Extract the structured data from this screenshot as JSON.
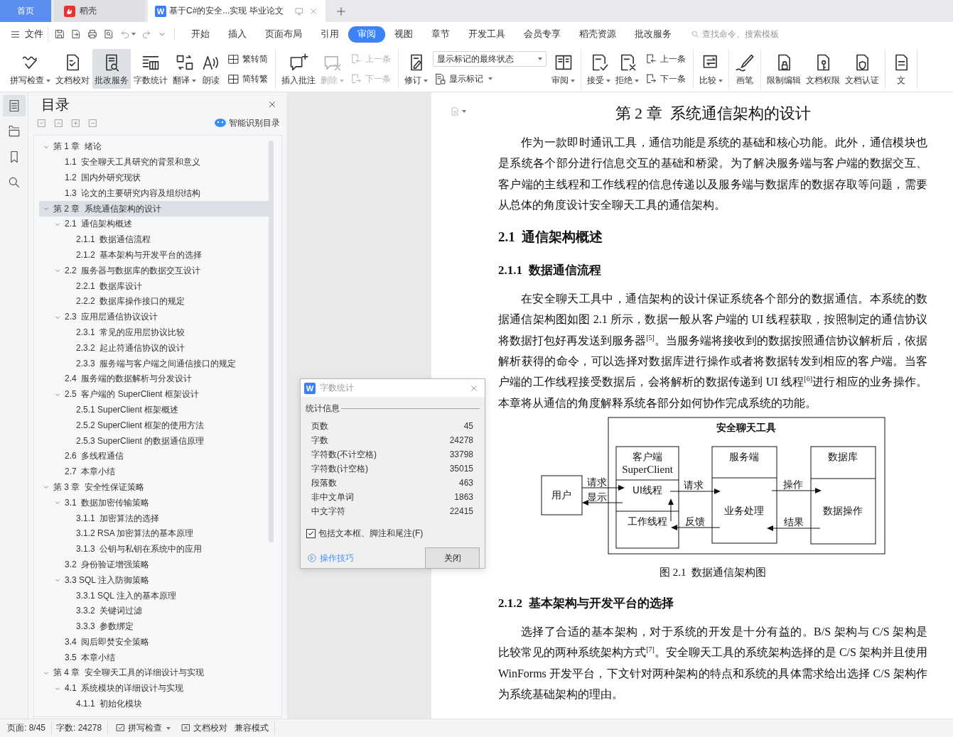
{
  "tabs": [
    {
      "kind": "home",
      "label": "首页",
      "selected": false
    },
    {
      "kind": "app",
      "label": "稻壳",
      "selected": false
    },
    {
      "kind": "document",
      "logo": "W",
      "label": "基于C#的安全...实现 毕业论文",
      "selected": true
    }
  ],
  "menu": {
    "file": "文件",
    "tabs": [
      {
        "label": "开始",
        "selected": false
      },
      {
        "label": "插入",
        "selected": false
      },
      {
        "label": "页面布局",
        "selected": false
      },
      {
        "label": "引用",
        "selected": false
      },
      {
        "label": "审阅",
        "selected": true
      },
      {
        "label": "视图",
        "selected": false
      },
      {
        "label": "章节",
        "selected": false
      },
      {
        "label": "开发工具",
        "selected": false
      },
      {
        "label": "会员专享",
        "selected": false
      },
      {
        "label": "稻壳资源",
        "selected": false
      },
      {
        "label": "批改服务",
        "selected": false
      }
    ],
    "search": {
      "placeholder": "查找命令、搜索模板"
    }
  },
  "ribbon": [
    [
      {
        "kind": "large",
        "label": "拼写检查",
        "menu": true,
        "disabled": false,
        "active": false
      },
      {
        "kind": "large",
        "label": "文档校对",
        "menu": false,
        "disabled": false,
        "active": false
      },
      {
        "kind": "large",
        "label": "批改服务",
        "menu": false,
        "disabled": false,
        "active": true
      },
      {
        "kind": "large",
        "label": "字数统计",
        "menu": false,
        "disabled": false,
        "active": false
      },
      {
        "kind": "large",
        "label": "翻译",
        "menu": true,
        "disabled": false,
        "active": false
      },
      {
        "kind": "large",
        "label": "朗读",
        "menu": false,
        "disabled": false,
        "active": false
      },
      {
        "kind": "stack",
        "items": [
          {
            "kind": "small",
            "label": "繁转简",
            "menu": false,
            "disabled": false
          },
          {
            "kind": "small",
            "label": "简转繁",
            "menu": false,
            "disabled": false
          }
        ]
      }
    ],
    [
      {
        "kind": "large",
        "label": "插入批注",
        "menu": false,
        "disabled": false,
        "active": false
      },
      {
        "kind": "large",
        "label": "删除",
        "menu": true,
        "disabled": true,
        "active": false
      },
      {
        "kind": "stack",
        "items": [
          {
            "kind": "small",
            "label": "上一条",
            "menu": false,
            "disabled": true
          },
          {
            "kind": "small",
            "label": "下一条",
            "menu": false,
            "disabled": true
          }
        ]
      }
    ],
    [
      {
        "kind": "large",
        "label": "修订",
        "menu": true,
        "disabled": false,
        "active": false
      },
      {
        "kind": "stack",
        "items": [
          {
            "kind": "select",
            "value": "显示标记的最终状态"
          },
          {
            "kind": "small",
            "label": "显示标记",
            "menu": true,
            "disabled": false
          }
        ]
      },
      {
        "kind": "large",
        "label": "审阅",
        "menu": true,
        "disabled": false,
        "active": false
      }
    ],
    [
      {
        "kind": "large",
        "label": "接受",
        "menu": true,
        "disabled": false,
        "active": false
      },
      {
        "kind": "large",
        "label": "拒绝",
        "menu": true,
        "disabled": false,
        "active": false
      },
      {
        "kind": "stack",
        "items": [
          {
            "kind": "small",
            "label": "上一条",
            "menu": false,
            "disabled": false
          },
          {
            "kind": "small",
            "label": "下一条",
            "menu": false,
            "disabled": false
          }
        ]
      }
    ],
    [
      {
        "kind": "large",
        "label": "比较",
        "menu": true,
        "disabled": false,
        "active": false
      }
    ],
    [
      {
        "kind": "large",
        "label": "画笔",
        "menu": false,
        "disabled": false,
        "active": false
      }
    ],
    [
      {
        "kind": "large",
        "label": "限制编辑",
        "menu": false,
        "disabled": false,
        "active": false
      },
      {
        "kind": "large",
        "label": "文档权限",
        "menu": false,
        "disabled": false,
        "active": false
      },
      {
        "kind": "large",
        "label": "文档认证",
        "menu": false,
        "disabled": false,
        "active": false
      }
    ],
    [
      {
        "kind": "large",
        "label": "文",
        "menu": false,
        "disabled": false,
        "active": false
      }
    ]
  ],
  "side_tools": [
    {
      "selected": true
    },
    {
      "selected": false
    },
    {
      "selected": false
    },
    {
      "selected": false
    }
  ],
  "toc": {
    "title": "目录",
    "smart_button": "智能识别目录",
    "items": [
      {
        "label": "第 1 章  绪论",
        "expanded": true,
        "selected": false,
        "children": [
          {
            "label": "1.1  安全聊天工具研究的背景和意义",
            "expanded": false,
            "selected": false
          },
          {
            "label": "1.2  国内外研究现状",
            "expanded": false,
            "selected": false
          },
          {
            "label": "1.3  论文的主要研究内容及组织结构",
            "expanded": false,
            "selected": false
          }
        ]
      },
      {
        "label": "第 2 章  系统通信架构的设计",
        "expanded": true,
        "selected": true,
        "children": [
          {
            "label": "2.1  通信架构概述",
            "expanded": true,
            "selected": false,
            "children": [
              {
                "label": "2.1.1  数据通信流程",
                "expanded": false,
                "selected": false
              },
              {
                "label": "2.1.2  基本架构与开发平台的选择",
                "expanded": false,
                "selected": false
              }
            ]
          },
          {
            "label": "2.2  服务器与数据库的数据交互设计",
            "expanded": true,
            "selected": false,
            "children": [
              {
                "label": "2.2.1  数据库设计",
                "expanded": false,
                "selected": false
              },
              {
                "label": "2.2.2  数据库操作接口的规定",
                "expanded": false,
                "selected": false
              }
            ]
          },
          {
            "label": "2.3  应用层通信协议设计",
            "expanded": true,
            "selected": false,
            "children": [
              {
                "label": "2.3.1  常见的应用层协议比较",
                "expanded": false,
                "selected": false
              },
              {
                "label": "2.3.2  起止符通信协议的设计",
                "expanded": false,
                "selected": false
              },
              {
                "label": "2.3.3  服务端与客户端之间通信接口的规定",
                "expanded": false,
                "selected": false
              }
            ]
          },
          {
            "label": "2.4  服务端的数据解析与分发设计",
            "expanded": false,
            "selected": false
          },
          {
            "label": "2.5  客户端的 SuperClient 框架设计",
            "expanded": true,
            "selected": false,
            "children": [
              {
                "label": "2.5.1 SuperClient 框架概述",
                "expanded": false,
                "selected": false
              },
              {
                "label": "2.5.2 SuperClient 框架的使用方法",
                "expanded": false,
                "selected": false
              },
              {
                "label": "2.5.3 SuperClient 的数据通信原理",
                "expanded": false,
                "selected": false
              }
            ]
          },
          {
            "label": "2.6  多线程通信",
            "expanded": false,
            "selected": false
          },
          {
            "label": "2.7  本章小结",
            "expanded": false,
            "selected": false
          }
        ]
      },
      {
        "label": "第 3 章  安全性保证策略",
        "expanded": true,
        "selected": false,
        "children": [
          {
            "label": "3.1  数据加密传输策略",
            "expanded": true,
            "selected": false,
            "children": [
              {
                "label": "3.1.1  加密算法的选择",
                "expanded": false,
                "selected": false
              },
              {
                "label": "3.1.2 RSA 加密算法的基本原理",
                "expanded": false,
                "selected": false
              },
              {
                "label": "3.1.3  公钥与私钥在系统中的应用",
                "expanded": false,
                "selected": false
              }
            ]
          },
          {
            "label": "3.2  身份验证增强策略",
            "expanded": false,
            "selected": false
          },
          {
            "label": "3.3 SQL 注入防御策略",
            "expanded": true,
            "selected": false,
            "children": [
              {
                "label": "3.3.1 SQL 注入的基本原理",
                "expanded": false,
                "selected": false
              },
              {
                "label": "3.3.2  关键词过滤",
                "expanded": false,
                "selected": false
              },
              {
                "label": "3.3.3  参数绑定",
                "expanded": false,
                "selected": false
              }
            ]
          },
          {
            "label": "3.4  阅后即焚安全策略",
            "expanded": false,
            "selected": false
          },
          {
            "label": "3.5  本章小结",
            "expanded": false,
            "selected": false
          }
        ]
      },
      {
        "label": "第 4 章  安全聊天工具的详细设计与实现",
        "expanded": true,
        "selected": false,
        "children": [
          {
            "label": "4.1  系统模块的详细设计与实现",
            "expanded": true,
            "selected": false,
            "children": [
              {
                "label": "4.1.1  初始化模块",
                "expanded": false,
                "selected": false
              }
            ]
          }
        ]
      }
    ]
  },
  "document": {
    "chapter_title": "第 2 章  系统通信架构的设计",
    "blocks": [
      {
        "kind": "paragraph",
        "text": "作为一款即时通讯工具，通信功能是系统的基础和核心功能。此外，通信模块也是系统各个部分进行信息交互的基础和桥梁。为了解决服务端与客户端的数据交互、客户端的主线程和工作线程的信息传递以及服务端与数据库的数据存取等问题，需要从总体的角度设计安全聊天工具的通信架构。"
      },
      {
        "kind": "heading2",
        "text": "2.1  通信架构概述"
      },
      {
        "kind": "heading3",
        "text": "2.1.1  数据通信流程"
      },
      {
        "kind": "paragraph",
        "text": "在安全聊天工具中，通信架构的设计保证系统各个部分的数据通信。本系统的数据通信架构图如图 2.1 所示，数据一般从客户端的 UI 线程获取，按照制定的通信协议将数据打包好再发送到服务器$^{[5]}$。当服务端将接收到的数据按照通信协议解析后，依据解析获得的命令，可以选择对数据库进行操作或者将数据转发到相应的客户端。当客户端的工作线程接受数据后，会将解析的数据传递到 UI 线程$^{[6]}$进行相应的业务操作。本章将从通信的角度解释系统各部分如何协作完成系统的功能。"
      },
      {
        "kind": "figure",
        "title": "安全聊天工具",
        "user": "用户",
        "client": {
          "header": [
            "客户端",
            "SuperClient"
          ],
          "ui_thread": "UI线程",
          "worker_thread": "工作线程"
        },
        "server": {
          "header": "服务端",
          "body": "业务处理"
        },
        "database": {
          "header": "数据库",
          "body": "数据操作"
        },
        "arrow_labels": [
          "请求",
          "显示",
          "请求",
          "反馈",
          "操作",
          "结果"
        ]
      },
      {
        "kind": "caption",
        "text": "图 2.1  数据通信架构图"
      },
      {
        "kind": "heading3",
        "text": "2.1.2  基本架构与开发平台的选择"
      },
      {
        "kind": "paragraph",
        "text": "选择了合适的基本架构，对于系统的开发是十分有益的。B/S 架构与 C/S 架构是比较常见的两种系统架构方式$^{[7]}$。安全聊天工具的系统架构选择的是 C/S 架构并且使用 WinForms 开发平台，下文针对两种架构的特点和系统的具体需求给出选择 C/S 架构作为系统基础架构的理由。"
      }
    ]
  },
  "dialog": {
    "logo": "W",
    "title": "字数统计",
    "section": "统计信息",
    "rows": [
      {
        "label": "页数",
        "value": "45"
      },
      {
        "label": "字数",
        "value": "24278"
      },
      {
        "label": "字符数(不计空格)",
        "value": "33798"
      },
      {
        "label": "字符数(计空格)",
        "value": "35015"
      },
      {
        "label": "段落数",
        "value": "463"
      },
      {
        "label": "非中文单词",
        "value": "1863"
      },
      {
        "label": "中文字符",
        "value": "22415"
      }
    ],
    "checkbox": {
      "label": "包括文本框、脚注和尾注(F)",
      "checked": true
    },
    "link": "操作技巧",
    "button": "关闭"
  },
  "status_bar": {
    "page": "页面: 8/45",
    "words": "字数: 24278",
    "spell": "拼写检查",
    "proof": "文档校对",
    "mode": "兼容模式"
  }
}
